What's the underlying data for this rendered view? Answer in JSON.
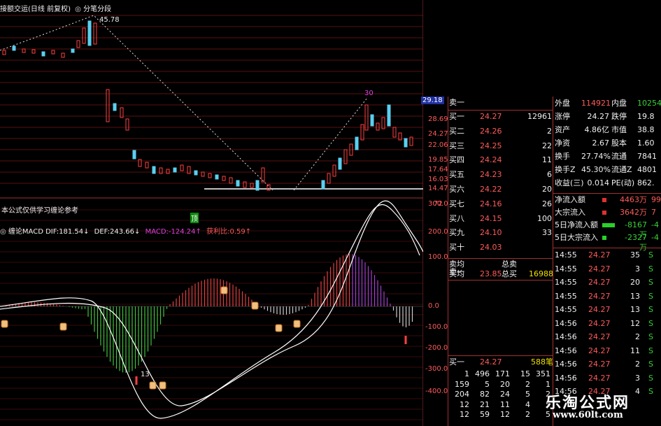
{
  "chart_header": {
    "title": "接额交运(日线 前复权)",
    "mode": "分笔分段"
  },
  "price_chart": {
    "peak_label": "45.78",
    "peak2_label": "30",
    "right_axis": [
      "29.18",
      "28.69",
      "24.27",
      "22.06",
      "19.85",
      "17.64",
      "16.03",
      "14.47",
      "72"
    ]
  },
  "indicator_note": "本公式仅供学习缠论参考",
  "indicator_marker": "顶",
  "macd_header": {
    "name": "缠论MACD",
    "dif": "DIF:181.54↓",
    "def": "DEF:243.66↓",
    "macd": "MACD:-124.24↑",
    "bias": "获利比:0.59↑"
  },
  "macd_axis": [
    "300.0",
    "200.0",
    "100.0",
    "0.0",
    "-100.0",
    "-200.0",
    "-300.0",
    "-400.0"
  ],
  "macd_labels": {
    "bottom_label": "13"
  },
  "book": {
    "sell1_label": "卖一",
    "buys": [
      {
        "label": "买一",
        "price": "24.27",
        "vol": "12961"
      },
      {
        "label": "买二",
        "price": "24.26",
        "vol": "2"
      },
      {
        "label": "买三",
        "price": "24.25",
        "vol": "22"
      },
      {
        "label": "买四",
        "price": "24.24",
        "vol": "11"
      },
      {
        "label": "买五",
        "price": "24.23",
        "vol": "6"
      },
      {
        "label": "买六",
        "price": "24.22",
        "vol": "20"
      },
      {
        "label": "买七",
        "price": "24.16",
        "vol": "26"
      },
      {
        "label": "买八",
        "price": "24.15",
        "vol": "100"
      },
      {
        "label": "买九",
        "price": "24.10",
        "vol": "33"
      },
      {
        "label": "买十",
        "price": "24.03",
        "vol": ""
      }
    ],
    "avg_sell_label": "卖均",
    "total_sell_label": "总卖",
    "avg_buy_label": "买均",
    "avg_buy": "23.85",
    "total_buy_label": "总买",
    "total_buy": "16988",
    "sell1b_label": "卖一",
    "buy1b_label": "买一",
    "buy1b_price": "24.27",
    "buy1b_vol": "588笔",
    "queue": [
      [
        "1",
        "496",
        "171",
        "15",
        "351"
      ],
      [
        "159",
        "5",
        "20",
        "2",
        "1"
      ],
      [
        "204",
        "82",
        "24",
        "5",
        "2"
      ],
      [
        "12",
        "21",
        "11",
        "4",
        "5"
      ],
      [
        "12",
        "59",
        "12",
        "2",
        "5"
      ]
    ]
  },
  "stats": [
    {
      "l1": "外盘",
      "v1": "114921",
      "l2": "内盘",
      "v2": "10254"
    },
    {
      "l1": "涨停",
      "v1": "24.27",
      "l2": "跌停",
      "v2": "19.8"
    },
    {
      "l1": "资产",
      "v1": "4.86亿",
      "l2": "市值",
      "v2": "38.8"
    },
    {
      "l1": "净资",
      "v1": "2.67",
      "l2": "股本",
      "v2": "1.60"
    },
    {
      "l1": "换手",
      "v1": "27.74%",
      "l2": "流通",
      "v2": "7841"
    },
    {
      "l1": "换手Z",
      "v1": "45.30%",
      "l2": "流通Z",
      "v2": "4801"
    },
    {
      "l1": "收益(三)",
      "v1": "0.014",
      "l2": "PE(动)",
      "v2": "862."
    }
  ],
  "flows": [
    {
      "label": "净流入额",
      "value": "4463万",
      "extra": "99"
    },
    {
      "label": "大宗流入",
      "value": "3642万",
      "extra": "7"
    },
    {
      "label": "5日净流入额",
      "value": "-8167万",
      "extra": "-4"
    },
    {
      "label": "5日大宗流入",
      "value": "-2327万",
      "extra": "-4"
    }
  ],
  "ticks": [
    {
      "t": "14:55",
      "p": "24.27",
      "v": "35",
      "s": "S"
    },
    {
      "t": "14:55",
      "p": "24.27",
      "v": "3",
      "s": "S"
    },
    {
      "t": "14:55",
      "p": "24.27",
      "v": "20",
      "s": "S"
    },
    {
      "t": "14:55",
      "p": "24.27",
      "v": "13",
      "s": "S"
    },
    {
      "t": "14:55",
      "p": "24.27",
      "v": "13",
      "s": "S"
    },
    {
      "t": "14:56",
      "p": "24.27",
      "v": "12",
      "s": "S"
    },
    {
      "t": "14:56",
      "p": "24.27",
      "v": "2",
      "s": "S"
    },
    {
      "t": "14:56",
      "p": "24.27",
      "v": "11",
      "s": "S"
    },
    {
      "t": "14:56",
      "p": "24.27",
      "v": "2",
      "s": "S"
    },
    {
      "t": "14:56",
      "p": "24.27",
      "v": "3",
      "s": "S"
    },
    {
      "t": "14:56",
      "p": "24.27",
      "v": "4",
      "s": "S"
    }
  ],
  "watermark": {
    "title": "乐淘公式网",
    "url": "www.60lt.com"
  }
}
